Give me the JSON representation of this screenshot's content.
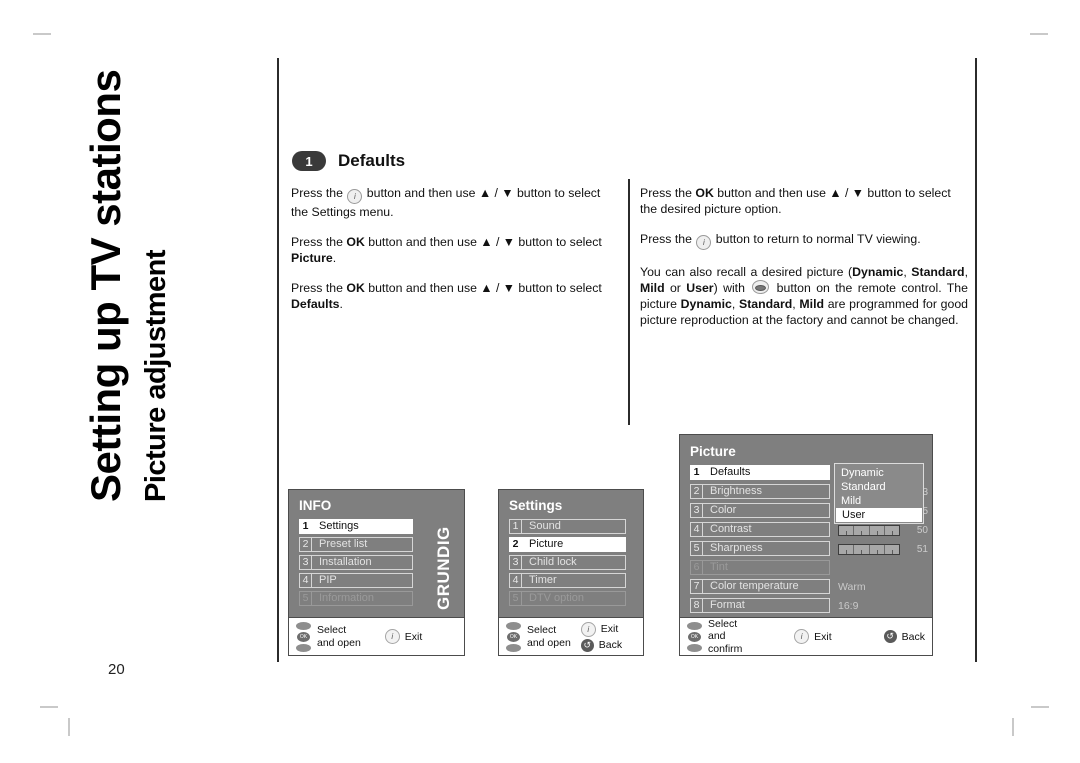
{
  "page": {
    "number": "20",
    "chapter_title": "Setting up TV stations",
    "chapter_subtitle": "Picture adjustment"
  },
  "section": {
    "step": "1",
    "heading": "Defaults"
  },
  "body": {
    "left": [
      {
        "parts": [
          {
            "t": "Press the ",
            "s": "n"
          },
          {
            "t": "i-button-icon",
            "s": "icon-i"
          },
          {
            "t": " button and then use ",
            "s": "n"
          },
          {
            "t": "▲ / ▼",
            "s": "n"
          },
          {
            "t": " button to select the Settings menu.",
            "s": "n"
          }
        ]
      },
      {
        "parts": [
          {
            "t": "Press the ",
            "s": "n"
          },
          {
            "t": "OK",
            "s": "b"
          },
          {
            "t": " button and then use ",
            "s": "n"
          },
          {
            "t": "▲ / ▼",
            "s": "n"
          },
          {
            "t": " button to select ",
            "s": "n"
          },
          {
            "t": "Picture",
            "s": "b"
          },
          {
            "t": ".",
            "s": "n"
          }
        ]
      },
      {
        "parts": [
          {
            "t": "Press the ",
            "s": "n"
          },
          {
            "t": "OK",
            "s": "b"
          },
          {
            "t": " button and then use ",
            "s": "n"
          },
          {
            "t": "▲ / ▼",
            "s": "n"
          },
          {
            "t": " button to select ",
            "s": "n"
          },
          {
            "t": "Defaults",
            "s": "b"
          },
          {
            "t": ".",
            "s": "n"
          }
        ]
      }
    ],
    "right": [
      {
        "parts": [
          {
            "t": "Press the ",
            "s": "n"
          },
          {
            "t": "OK",
            "s": "b"
          },
          {
            "t": " button and then use ",
            "s": "n"
          },
          {
            "t": "▲ / ▼",
            "s": "n"
          },
          {
            "t": " button to select the desired picture option.",
            "s": "n"
          }
        ]
      },
      {
        "parts": [
          {
            "t": "Press the ",
            "s": "n"
          },
          {
            "t": "i-button-icon",
            "s": "icon-i"
          },
          {
            "t": " button to return to normal TV viewing.",
            "s": "n"
          }
        ]
      },
      {
        "parts": [
          {
            "t": "You can also recall a desired picture (",
            "s": "n"
          },
          {
            "t": "Dynamic",
            "s": "b"
          },
          {
            "t": ", ",
            "s": "n"
          },
          {
            "t": "Standard",
            "s": "b"
          },
          {
            "t": ", ",
            "s": "n"
          },
          {
            "t": "Mild",
            "s": "b"
          },
          {
            "t": " or ",
            "s": "n"
          },
          {
            "t": "User",
            "s": "b"
          },
          {
            "t": ") with ",
            "s": "n"
          },
          {
            "t": "eye-button-icon",
            "s": "icon-eye"
          },
          {
            "t": " button on the remote control. The picture ",
            "s": "n"
          },
          {
            "t": "Dynamic",
            "s": "b"
          },
          {
            "t": ", ",
            "s": "n"
          },
          {
            "t": "Standard",
            "s": "b"
          },
          {
            "t": ", ",
            "s": "n"
          },
          {
            "t": "Mild",
            "s": "b"
          },
          {
            "t": " are programmed for good picture reproduction at the factory and cannot be changed.",
            "s": "n"
          }
        ]
      }
    ]
  },
  "osd_info": {
    "title": "INFO",
    "brand": "GRUNDIG",
    "rows": [
      {
        "num": "1",
        "label": "Settings",
        "state": "selected"
      },
      {
        "num": "2",
        "label": "Preset list",
        "state": "normal"
      },
      {
        "num": "3",
        "label": "Installation",
        "state": "normal"
      },
      {
        "num": "4",
        "label": "PIP",
        "state": "normal"
      },
      {
        "num": "5",
        "label": "Information",
        "state": "dim"
      }
    ],
    "footer": {
      "nav_line1": "Select",
      "nav_line2": "and open",
      "exit_label": "Exit",
      "exit_glyph": "i"
    }
  },
  "osd_settings": {
    "title": "Settings",
    "rows": [
      {
        "num": "1",
        "label": "Sound",
        "state": "normal"
      },
      {
        "num": "2",
        "label": "Picture",
        "state": "selected"
      },
      {
        "num": "3",
        "label": "Child lock",
        "state": "normal"
      },
      {
        "num": "4",
        "label": "Timer",
        "state": "normal"
      },
      {
        "num": "5",
        "label": "DTV option",
        "state": "dim"
      }
    ],
    "footer": {
      "nav_line1": "Select",
      "nav_line2": "and open",
      "exit_label": "Exit",
      "exit_glyph": "i",
      "back_label": "Back",
      "back_glyph": "↺"
    }
  },
  "osd_picture": {
    "title": "Picture",
    "rows": [
      {
        "num": "1",
        "label": "Defaults",
        "state": "selected"
      },
      {
        "num": "2",
        "label": "Brightness",
        "state": "normal"
      },
      {
        "num": "3",
        "label": "Color",
        "state": "normal"
      },
      {
        "num": "4",
        "label": "Contrast",
        "state": "normal"
      },
      {
        "num": "5",
        "label": "Sharpness",
        "state": "normal"
      },
      {
        "num": "6",
        "label": "Tint",
        "state": "dim"
      },
      {
        "num": "7",
        "label": "Color temperature",
        "state": "normal"
      },
      {
        "num": "8",
        "label": "Format",
        "state": "normal"
      }
    ],
    "values": [
      {
        "kind": "none",
        "text": "",
        "num": ""
      },
      {
        "kind": "number",
        "text": "",
        "num": "3"
      },
      {
        "kind": "number",
        "text": "",
        "num": "5"
      },
      {
        "kind": "bar",
        "text": "",
        "num": "50"
      },
      {
        "kind": "bar",
        "text": "",
        "num": "51"
      },
      {
        "kind": "none",
        "text": "",
        "num": ""
      },
      {
        "kind": "text",
        "text": "Warm",
        "num": ""
      },
      {
        "kind": "text",
        "text": "16:9",
        "num": ""
      }
    ],
    "dropdown": {
      "items": [
        "Dynamic",
        "Standard",
        "Mild",
        "User"
      ],
      "selected": "User"
    },
    "footer": {
      "nav_line1": "Select",
      "nav_line2": "and confirm",
      "exit_label": "Exit",
      "exit_glyph": "i",
      "back_label": "Back",
      "back_glyph": "↺"
    }
  },
  "colors": {
    "osd_background": "#7f7f7f",
    "osd_selected": "#ffffff",
    "osd_dim_text": "#9a9a9a",
    "rule": "#2b2b2b",
    "step_pill": "#3a3a3a",
    "crop_mark": "#c9c9c9"
  }
}
